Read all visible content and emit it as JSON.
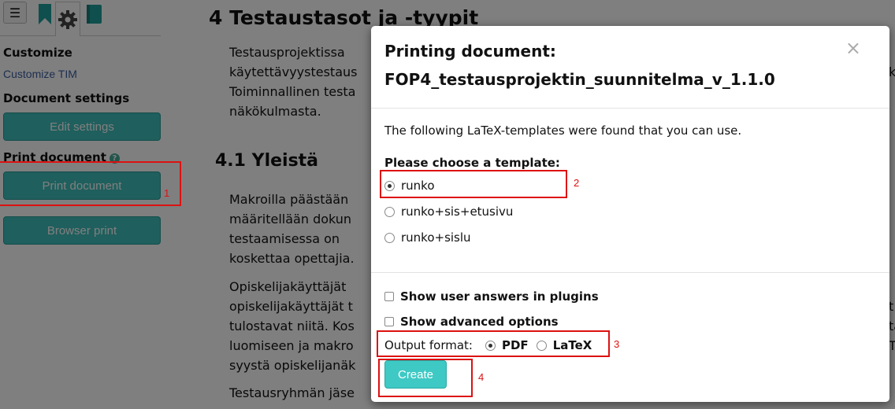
{
  "sidebar": {
    "tabs": [
      {
        "icon": "hamburger-icon",
        "glyph": "☰"
      },
      {
        "icon": "bookmark-icon"
      },
      {
        "icon": "gear-icon"
      },
      {
        "icon": "book-icon"
      }
    ],
    "customize_heading": "Customize",
    "customize_link": "Customize TIM",
    "doc_settings_heading": "Document settings",
    "edit_settings_button": "Edit settings",
    "print_heading": "Print document",
    "print_button": "Print document",
    "browser_print_button": "Browser print"
  },
  "document": {
    "h1": "4 Testaustasot ja -tyypit",
    "lines1": [
      "Testausprojektissa",
      "käytettävyystestaus",
      "Toiminnallinen testa",
      "näkökulmasta."
    ],
    "h2": "4.1 Yleistä",
    "lines2": [
      "Makroilla päästään",
      "määritellään dokun",
      "testaamisessa on",
      "koskettaa opettajia."
    ],
    "lines3": [
      "Opiskelijakäyttäjät",
      "opiskelijakäyttäjät t",
      "tulostavat niitä. Kos",
      "luomiseen ja makro",
      "syystä opiskelijanäk"
    ],
    "lines4": [
      "Testausryhmän jäse"
    ],
    "right_edge": [
      "ks",
      "t",
      "ta",
      "T"
    ]
  },
  "modal": {
    "title_line1": "Printing document:",
    "title_line2": "FOP4_testausprojektin_suunnitelma_v_1.1.0",
    "close_glyph": "×",
    "intro": "The following LaTeX-templates were found that you can use.",
    "choose_label": "Please choose a template:",
    "templates": [
      {
        "label": "runko",
        "selected": true
      },
      {
        "label": "runko+sis+etusivu",
        "selected": false
      },
      {
        "label": "runko+sislu",
        "selected": false
      }
    ],
    "show_answers_label": "Show user answers in plugins",
    "show_advanced_label": "Show advanced options",
    "output_format_label": "Output format:",
    "formats": [
      {
        "label": "PDF",
        "selected": true
      },
      {
        "label": "LaTeX",
        "selected": false
      }
    ],
    "create_button": "Create"
  },
  "annotations": [
    "1",
    "2",
    "3",
    "4"
  ],
  "colors": {
    "teal_button": "#3ebfba",
    "annotation": "#dd1111",
    "link": "#3c5fa3"
  }
}
